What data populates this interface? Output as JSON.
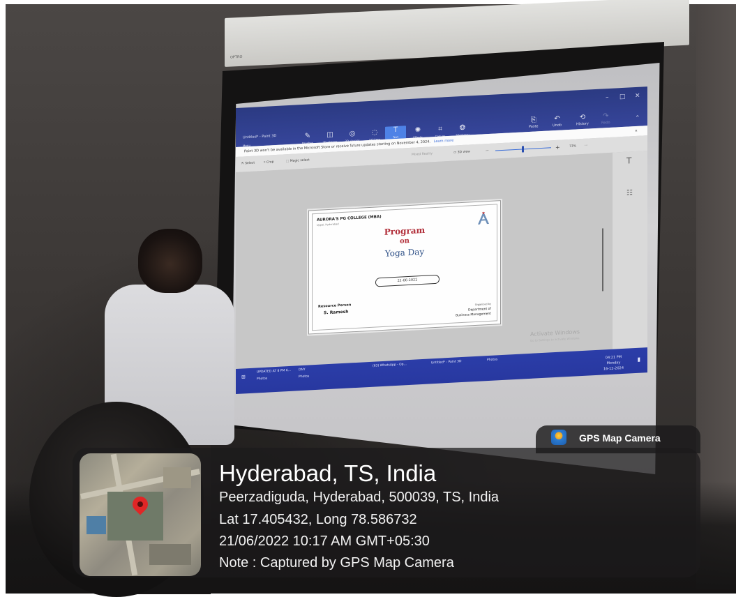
{
  "projector": {
    "brand": "OPTRO"
  },
  "app": {
    "title": "Untitled* - Paint 3D",
    "menu_label": "Menu",
    "tools": [
      "Brushes",
      "2D shapes",
      "3D shapes",
      "Stickers",
      "Text",
      "Effects",
      "Canvas",
      "3D library"
    ],
    "right_tools": [
      "Paste",
      "Undo",
      "History",
      "Redo"
    ],
    "notice": "Paint 3D won't be available in the Microsoft Store or receive future updates starting on November 4, 2024.",
    "notice_link": "Learn more",
    "subbar": [
      "Select",
      "Crop",
      "Magic select",
      "Mixed Reality",
      "3D view",
      "73%"
    ]
  },
  "slide": {
    "college": "AURORA'S PG COLLEGE (MBA)",
    "college_sub": "Uppal, Hyderabad",
    "title": "Program",
    "on": "on",
    "subtitle": "Yoga Day",
    "date": "21-06-2022",
    "resource_label": "Resource Person",
    "resource_name": "S. Ramesh",
    "organized_by": "Organized by",
    "dept1": "Department of",
    "dept2": "Business Management"
  },
  "watermark": {
    "title": "Activate Windows",
    "sub": "Go to Settings to activate Windows."
  },
  "taskbar": {
    "items": [
      "UPDATED AT 8 PM 6...",
      "DNY",
      "(63) WhatsApp - Op...",
      "Untitled* - Paint 3D",
      "Photos",
      "Photos",
      "Photos"
    ],
    "time": "04:21 PM",
    "day": "Monday",
    "date": "16-12-2024"
  },
  "gps": {
    "badge": "GPS Map Camera",
    "city": "Hyderabad, TS, India",
    "address": "Peerzadiguda, Hyderabad, 500039, TS, India",
    "coords": "Lat 17.405432, Long 78.586732",
    "datetime": "21/06/2022 10:17 AM GMT+05:30",
    "note": "Note : Captured by GPS Map Camera"
  }
}
